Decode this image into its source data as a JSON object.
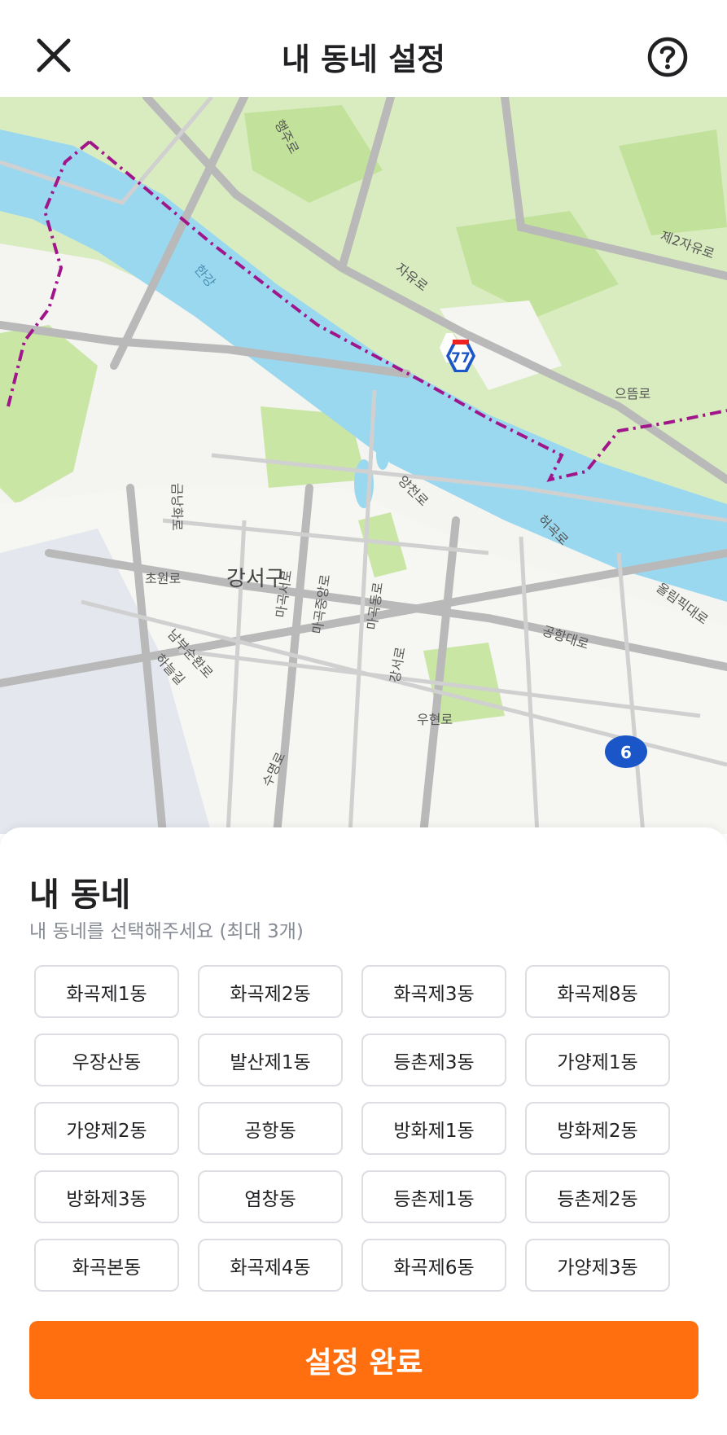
{
  "header": {
    "title": "내 동네 설정",
    "close_icon": "close-icon",
    "help_icon": "question-circle-icon"
  },
  "map": {
    "district_label": "강서구",
    "river_label": "한강",
    "road_labels": [
      "행주로",
      "자유로",
      "제2자유로",
      "으뜸로",
      "양천로",
      "허곡로",
      "올림픽대로",
      "공항대로",
      "우현로",
      "강서로",
      "남부순환로",
      "하늘길",
      "초원로",
      "금낭화로",
      "마곡서로",
      "마곡중앙로",
      "마곡동로",
      "수명로"
    ],
    "route_shields": [
      "77",
      "6"
    ],
    "colors": {
      "water": "#9ad8f0",
      "park": "#c9e6a5",
      "boundary": "#a0168a",
      "road": "#b9b9b9"
    }
  },
  "sheet": {
    "title": "내 동네",
    "subtitle": "내 동네를 선택해주세요 (최대 3개)",
    "neighborhoods": [
      "화곡제1동",
      "화곡제2동",
      "화곡제3동",
      "화곡제8동",
      "우장산동",
      "발산제1동",
      "등촌제3동",
      "가양제1동",
      "가양제2동",
      "공항동",
      "방화제1동",
      "방화제2동",
      "방화제3동",
      "염창동",
      "등촌제1동",
      "등촌제2동",
      "화곡본동",
      "화곡제4동",
      "화곡제6동",
      "가양제3동"
    ],
    "confirm_label": "설정 완료"
  },
  "theme": {
    "accent": "#ff6f0f",
    "chip_border": "#dcdee3",
    "subtext": "#868b94"
  }
}
